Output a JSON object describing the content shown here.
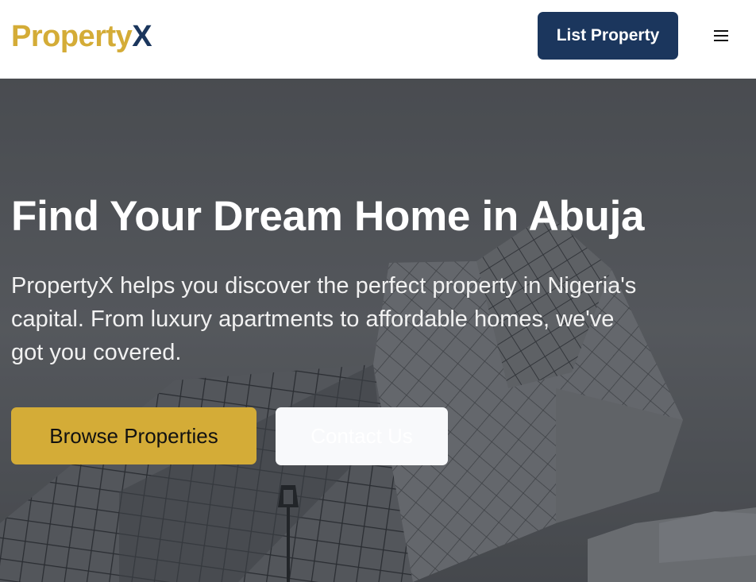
{
  "header": {
    "logo_part1": "Property",
    "logo_part2": "X",
    "list_property_label": "List Property",
    "menu_icon": "hamburger-menu-icon"
  },
  "hero": {
    "title": "Find Your Dream Home in Abuja",
    "subtitle": "PropertyX helps you discover the perfect property in Nigeria's capital. From luxury apartments to affordable homes, we've got you covered.",
    "browse_label": "Browse Properties",
    "contact_label": "Contact Us"
  },
  "colors": {
    "brand_gold": "#d4ac37",
    "brand_navy": "#1b365d",
    "hero_overlay": "#4a4e54"
  }
}
